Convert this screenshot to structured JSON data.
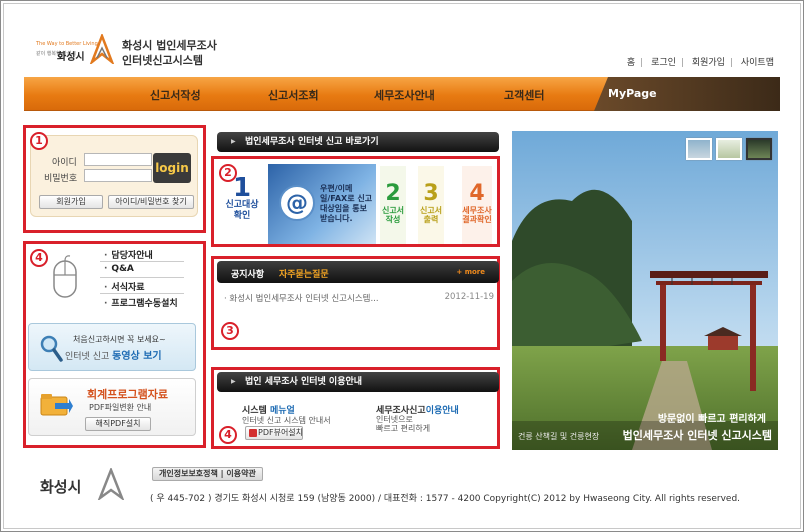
{
  "header": {
    "logo_tagline": "The Way to Better Living",
    "logo_subtagline": "같이 행복한 화성시",
    "logo_city": "화성시",
    "title_line1": "화성시 법인세무조사",
    "title_line2": "인터넷신고시스템"
  },
  "util_nav": [
    "홈",
    "로그인",
    "회원가입",
    "사이트맵"
  ],
  "gnb": {
    "items": [
      "신고서작성",
      "신고서조회",
      "세무조사안내",
      "고객센터"
    ],
    "mypage": "MyPage"
  },
  "annotations": [
    "1",
    "2",
    "3",
    "4",
    "4"
  ],
  "login": {
    "id_label": "아이디",
    "pw_label": "비밀번호",
    "login_button": "login",
    "join_button": "회원가입",
    "find_button": "아이디/비밀번호 찾기"
  },
  "side_menu": [
    "담당자안내",
    "Q&A",
    "서식자료",
    "프로그램수동설치"
  ],
  "banner_video": {
    "line1": "처음신고하시면 꼭 보세요~",
    "line2a": "인터넷 신고 ",
    "line2b": "동영상 보기"
  },
  "banner_pdf": {
    "title": "회계프로그램자료",
    "subtitle": "PDF파일변환 안내",
    "button": "해직PDF설치"
  },
  "shortcut": {
    "header": "법인세무조사 인터넷 신고 바로가기",
    "step1_num": "1",
    "step1_label": "신고대상 확인",
    "mail_text": "우편/이메일/FAX로 신고대상임을 통보 받습니다.",
    "steps": [
      {
        "num": "2",
        "label": "신고서 작성",
        "color": "#2a9b3c"
      },
      {
        "num": "3",
        "label": "신고서 출력",
        "color": "#b9a01a"
      },
      {
        "num": "4",
        "label": "세무조사 결과확인",
        "color": "#e0672a"
      }
    ]
  },
  "notice": {
    "tab_active": "공지사항",
    "tab_other": "자주묻는질문",
    "more": "more",
    "items": [
      {
        "title": "화성시 법인세무조사 인터넷 신고시스템...",
        "date": "2012-11-19"
      }
    ]
  },
  "usage": {
    "header": "법인 세무조사 인터넷 이용안내",
    "col1_title_a": "시스템 ",
    "col1_title_b": "메뉴얼",
    "col1_desc": "인터넷 신고 시스템 안내서",
    "col1_btn": "PDF뷰어설치",
    "col2_title_a": "세무조사신고",
    "col2_title_b": "이용안내",
    "col2_desc1": "인터넷으로",
    "col2_desc2": "빠르고 편리하게"
  },
  "photo": {
    "caption_small": "방문없이 빠르고 편리하게",
    "caption_big": "법인세무조사 인터넷 신고시스템",
    "caption_left": "건릉 산책길 및 건릉현장"
  },
  "footer": {
    "logo_text": "화성시",
    "policy": "개인정보보호정책 | 이용약관",
    "address": "( 우 445-702 ) 경기도 화성시 시청로 159 (남양동 2000) / 대표전화 : 1577 - 4200 Copyright(C) 2012 by Hwaseong City. All rights reserved."
  },
  "colors": {
    "accent": "#e87b12",
    "annotation": "#d9202a",
    "mypage": "#4a3420"
  }
}
